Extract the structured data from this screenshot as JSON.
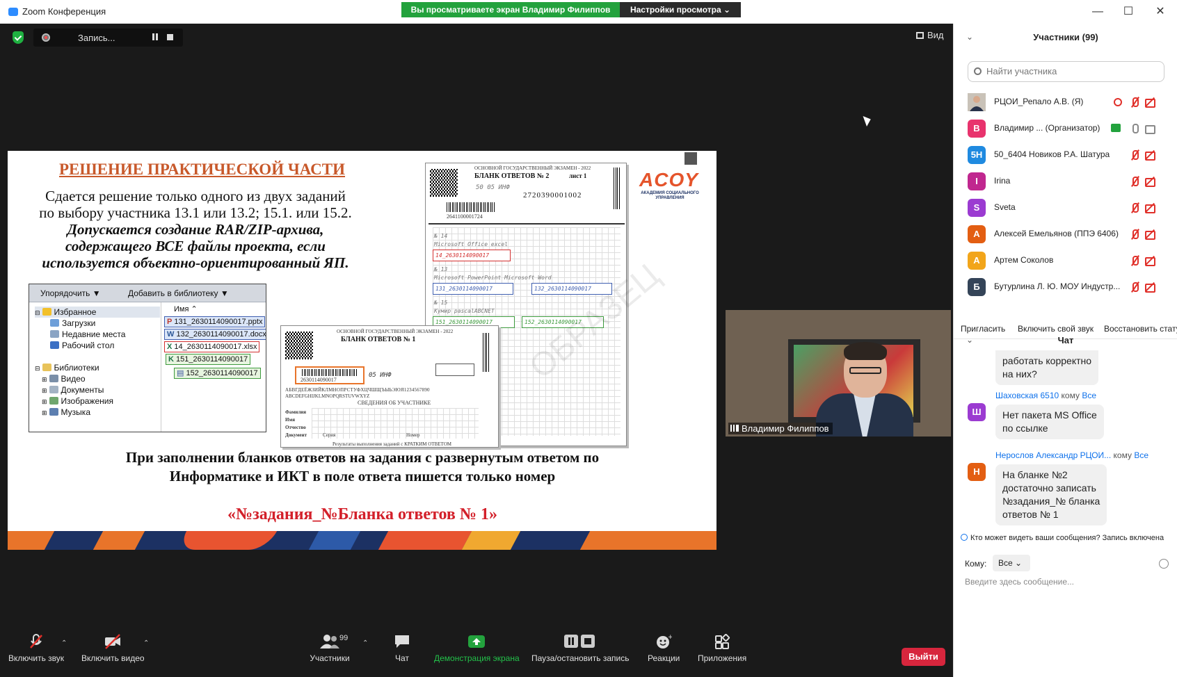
{
  "window": {
    "title": "Zoom Конференция",
    "share_banner": "Вы просматриваете экран Владимир Филиппов",
    "view_settings": "Настройки просмотра ⌄",
    "min": "—",
    "max": "☐",
    "close": "✕"
  },
  "stage": {
    "recording_label": "Запись...",
    "view_label": "Вид"
  },
  "slide": {
    "title": "РЕШЕНИЕ ПРАКТИЧЕСКОЙ ЧАСТИ",
    "p1_line1": "Сдается решение только одного из двух заданий",
    "p1_line2": "по выбору участника  13.1 или 13.2; 15.1. или 15.2.",
    "p2_line1": "Допускается создание RAR/ZIP-архива,",
    "p2_line2": "содержащего ВСЕ файлы проекта, если",
    "p2_line3": "используется объектно-ориентированный ЯП.",
    "p3_line1": "При заполнении бланков ответов на задания с развернутым ответом по",
    "p3_line2": "Информатике и ИКТ в поле ответа пишется только номер",
    "p4": "«№задания_№Бланка ответов № 1»",
    "logo": "ACOY",
    "logo_sub": "АКАДЕМИЯ СОЦИАЛЬНОГО УПРАВЛЕНИЯ",
    "watermark": "ОБРАЗЕЦ",
    "explorer": {
      "sort_btn": "Упорядочить ▼",
      "add_btn": "Добавить в библиотеку ▼",
      "col_name": "Имя ⌃",
      "tree": [
        "Избранное",
        "Загрузки",
        "Недавние места",
        "Рабочий стол",
        "Библиотеки",
        "Видео",
        "Документы",
        "Изображения",
        "Музыка"
      ],
      "files": [
        "131_2630114090017.pptx",
        "132_2630114090017.docx",
        "14_2630114090017.xlsx",
        "151_2630114090017",
        "152_2630114090017"
      ]
    },
    "form2": {
      "header": "ОСНОВНОЙ ГОСУДАРСТВЕННЫЙ ЭКЗАМЕН - 2022",
      "title": "БЛАНК ОТВЕТОВ № 2",
      "sheet": "лист 1",
      "number": "2720390001002",
      "code_left": "50  05  ИНФ",
      "barcode_text": "2641100001724",
      "h1": "№ 14",
      "h1_note": "Microsoft Office excel",
      "box1": "14_2630114090017",
      "h2": "№ 13",
      "h2_note": "Microsoft PowerPoint  Microsoft Word",
      "box2a": "131_2630114090017",
      "box2b": "132_2630114090017",
      "h3": "№ 15",
      "h3_note": "Кумир          pascalABCNET",
      "box3a": "151_2630114090017",
      "box3b": "152_2630114090017"
    },
    "form1": {
      "header": "ОСНОВНОЙ ГОСУДАРСТВЕННЫЙ ЭКЗАМЕН - 2022",
      "title": "БЛАНК ОТВЕТОВ № 1",
      "barcode_text": "2630114090017",
      "code": "05  ИНФ",
      "alphabet": "АБВГДЕЁЖЗИЙКЛМНОПРСТУФХЦЧШЩЪЫЬЭЮЯ1234567890",
      "alphabet2": "ABCDEFGHIJKLMNOPQRSTUVWXYZ",
      "section": "СВЕДЕНИЯ ОБ УЧАСТНИКЕ",
      "f_lastname": "Фамилия",
      "f_name": "Имя",
      "f_patronymic": "Отчество",
      "f_doc": "Документ",
      "f_series": "Серия",
      "f_number": "Номер",
      "footer": "Результаты выполнения заданий с КРАТКИМ ОТВЕТОМ"
    }
  },
  "video": {
    "name": "Владимир Филиппов"
  },
  "toolbar": {
    "mic": "Включить звук",
    "video": "Включить видео",
    "participants": "Участники",
    "participants_count": "99",
    "chat": "Чат",
    "share": "Демонстрация экрана",
    "record": "Пауза/остановить запись",
    "reactions": "Реакции",
    "apps": "Приложения",
    "exit": "Выйти"
  },
  "panel": {
    "participants_title": "Участники (99)",
    "search_placeholder": "Найти участника",
    "participants": [
      {
        "initial": "",
        "name": "РЦОИ_Репало А.В. (Я)",
        "color": "#8a7f73"
      },
      {
        "initial": "В",
        "name": "Владимир ...  (Организатор)",
        "color": "#e8336d"
      },
      {
        "initial": "5Н",
        "name": "50_6404  Новиков Р.А. Шатура",
        "color": "#1f8ae0"
      },
      {
        "initial": "I",
        "name": "Irina",
        "color": "#c0278f"
      },
      {
        "initial": "S",
        "name": "Sveta",
        "color": "#9b3bd1"
      },
      {
        "initial": "А",
        "name": "Алексей Емельянов (ППЭ 6406)",
        "color": "#e35e12"
      },
      {
        "initial": "А",
        "name": "Артем Соколов",
        "color": "#f2a51a"
      },
      {
        "initial": "Б",
        "name": "Бутурлина Л. Ю. МОУ Индустр...",
        "color": "#344458"
      }
    ],
    "actions": [
      "Пригласить",
      "Включить свой звук",
      "Восстановить статус"
    ],
    "chat_title": "Чат",
    "chat": [
      {
        "text_a": "работать корректно",
        "text_b": "на них?"
      },
      {
        "initial": "Ш",
        "color": "#9b3bd1",
        "sender": "Шаховская 6510",
        "to_word": "кому",
        "to": "Все",
        "text_a": "Нет пакета MS Office",
        "text_b": "по ссылке"
      },
      {
        "initial": "Н",
        "color": "#e35e12",
        "sender": "Нерослов Александр РЦОИ...",
        "to_word": "кому",
        "to": "Все",
        "text_a": "На бланке №2",
        "text_b": "достаточно записать",
        "text_c": "№задания_№ бланка",
        "text_d": "ответов № 1"
      }
    ],
    "who_can_see": "Кто может видеть ваши сообщения? Запись включена",
    "to_label": "Кому:",
    "to_value": "Все ⌄",
    "input_placeholder": "Введите здесь сообщение..."
  }
}
